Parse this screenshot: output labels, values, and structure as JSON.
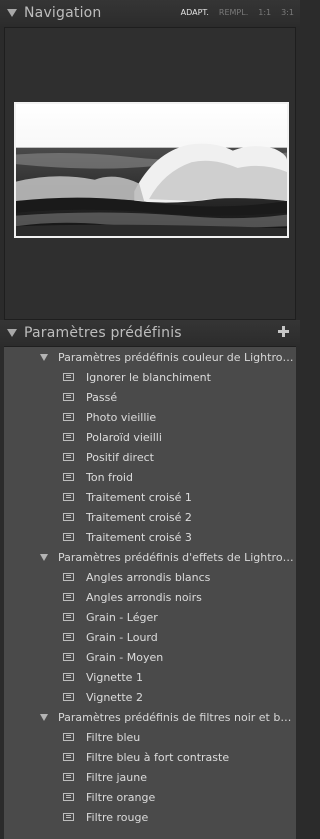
{
  "navigator": {
    "title": "Navigation",
    "zoom_options": [
      {
        "label": "ADAPT.",
        "active": true
      },
      {
        "label": "REMPL.",
        "active": false
      },
      {
        "label": "1:1",
        "active": false
      },
      {
        "label": "3:1",
        "active": false
      }
    ]
  },
  "presets": {
    "title": "Paramètres prédéfinis",
    "folders": [
      {
        "label": "Paramètres prédéfinis couleur de Lightroom",
        "items": [
          "Ignorer le blanchiment",
          "Passé",
          "Photo vieillie",
          "Polaroïd vieilli",
          "Positif direct",
          "Ton froid",
          "Traitement croisé 1",
          "Traitement croisé 2",
          "Traitement croisé 3"
        ]
      },
      {
        "label": "Paramètres prédéfinis d'effets de Lightroom",
        "items": [
          "Angles arrondis blancs",
          "Angles arrondis noirs",
          "Grain - Léger",
          "Grain - Lourd",
          "Grain - Moyen",
          "Vignette 1",
          "Vignette 2"
        ]
      },
      {
        "label": "Paramètres prédéfinis de filtres noir et bla...",
        "items": [
          "Filtre bleu",
          "Filtre bleu à fort contraste",
          "Filtre jaune",
          "Filtre orange",
          "Filtre rouge"
        ]
      }
    ]
  }
}
